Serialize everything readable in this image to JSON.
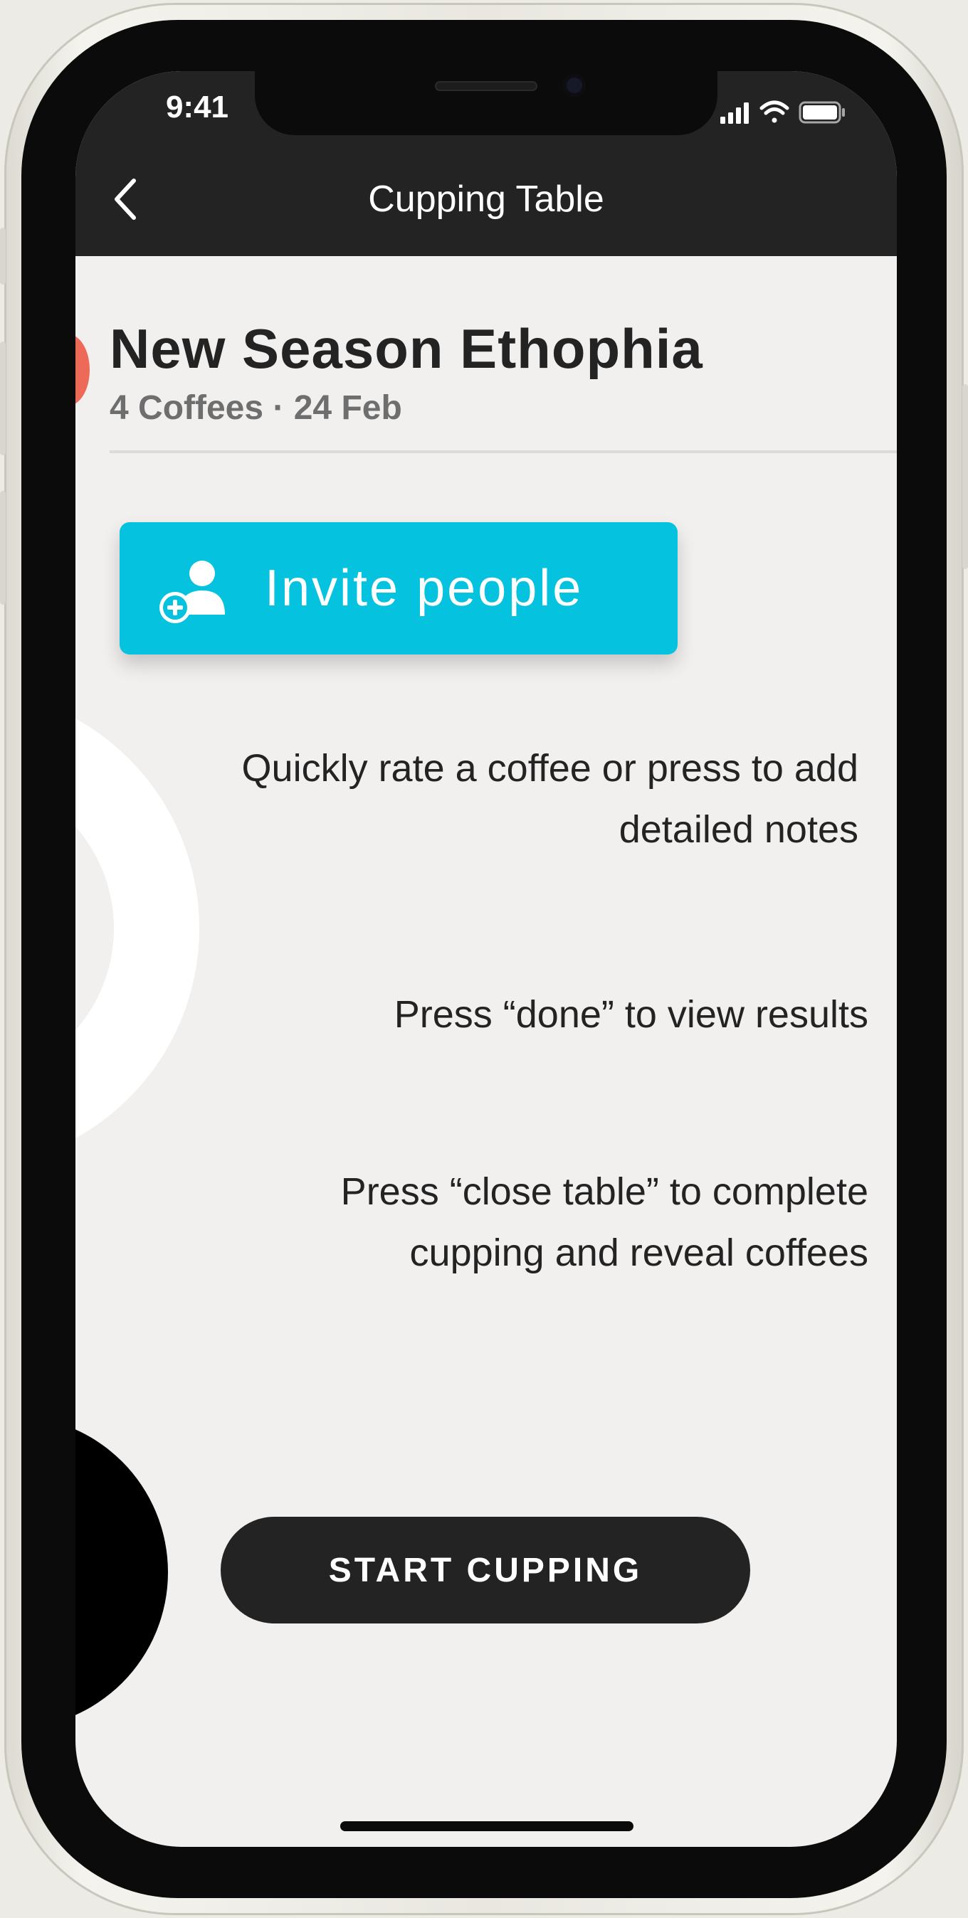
{
  "status_bar": {
    "time": "9:41",
    "icons": [
      "signal-icon",
      "wifi-icon",
      "battery-icon"
    ]
  },
  "navbar": {
    "title": "Cupping Table",
    "back_icon": "chevron-left-icon"
  },
  "table": {
    "title": "New Season Ethophia",
    "subtitle": "4 Coffees · 24 Feb"
  },
  "invite": {
    "label": "Invite people",
    "icon": "add-user-icon"
  },
  "tips": [
    "Quickly rate a coffee or press to add detailed notes",
    "Press “done” to view results",
    "Press “close table” to complete cupping and reveal coffees"
  ],
  "start_button": {
    "label": "START CUPPING"
  },
  "colors": {
    "accent": "#05c2df",
    "dark": "#232323",
    "background": "#f1f0ef",
    "red": "#ec6a57"
  }
}
